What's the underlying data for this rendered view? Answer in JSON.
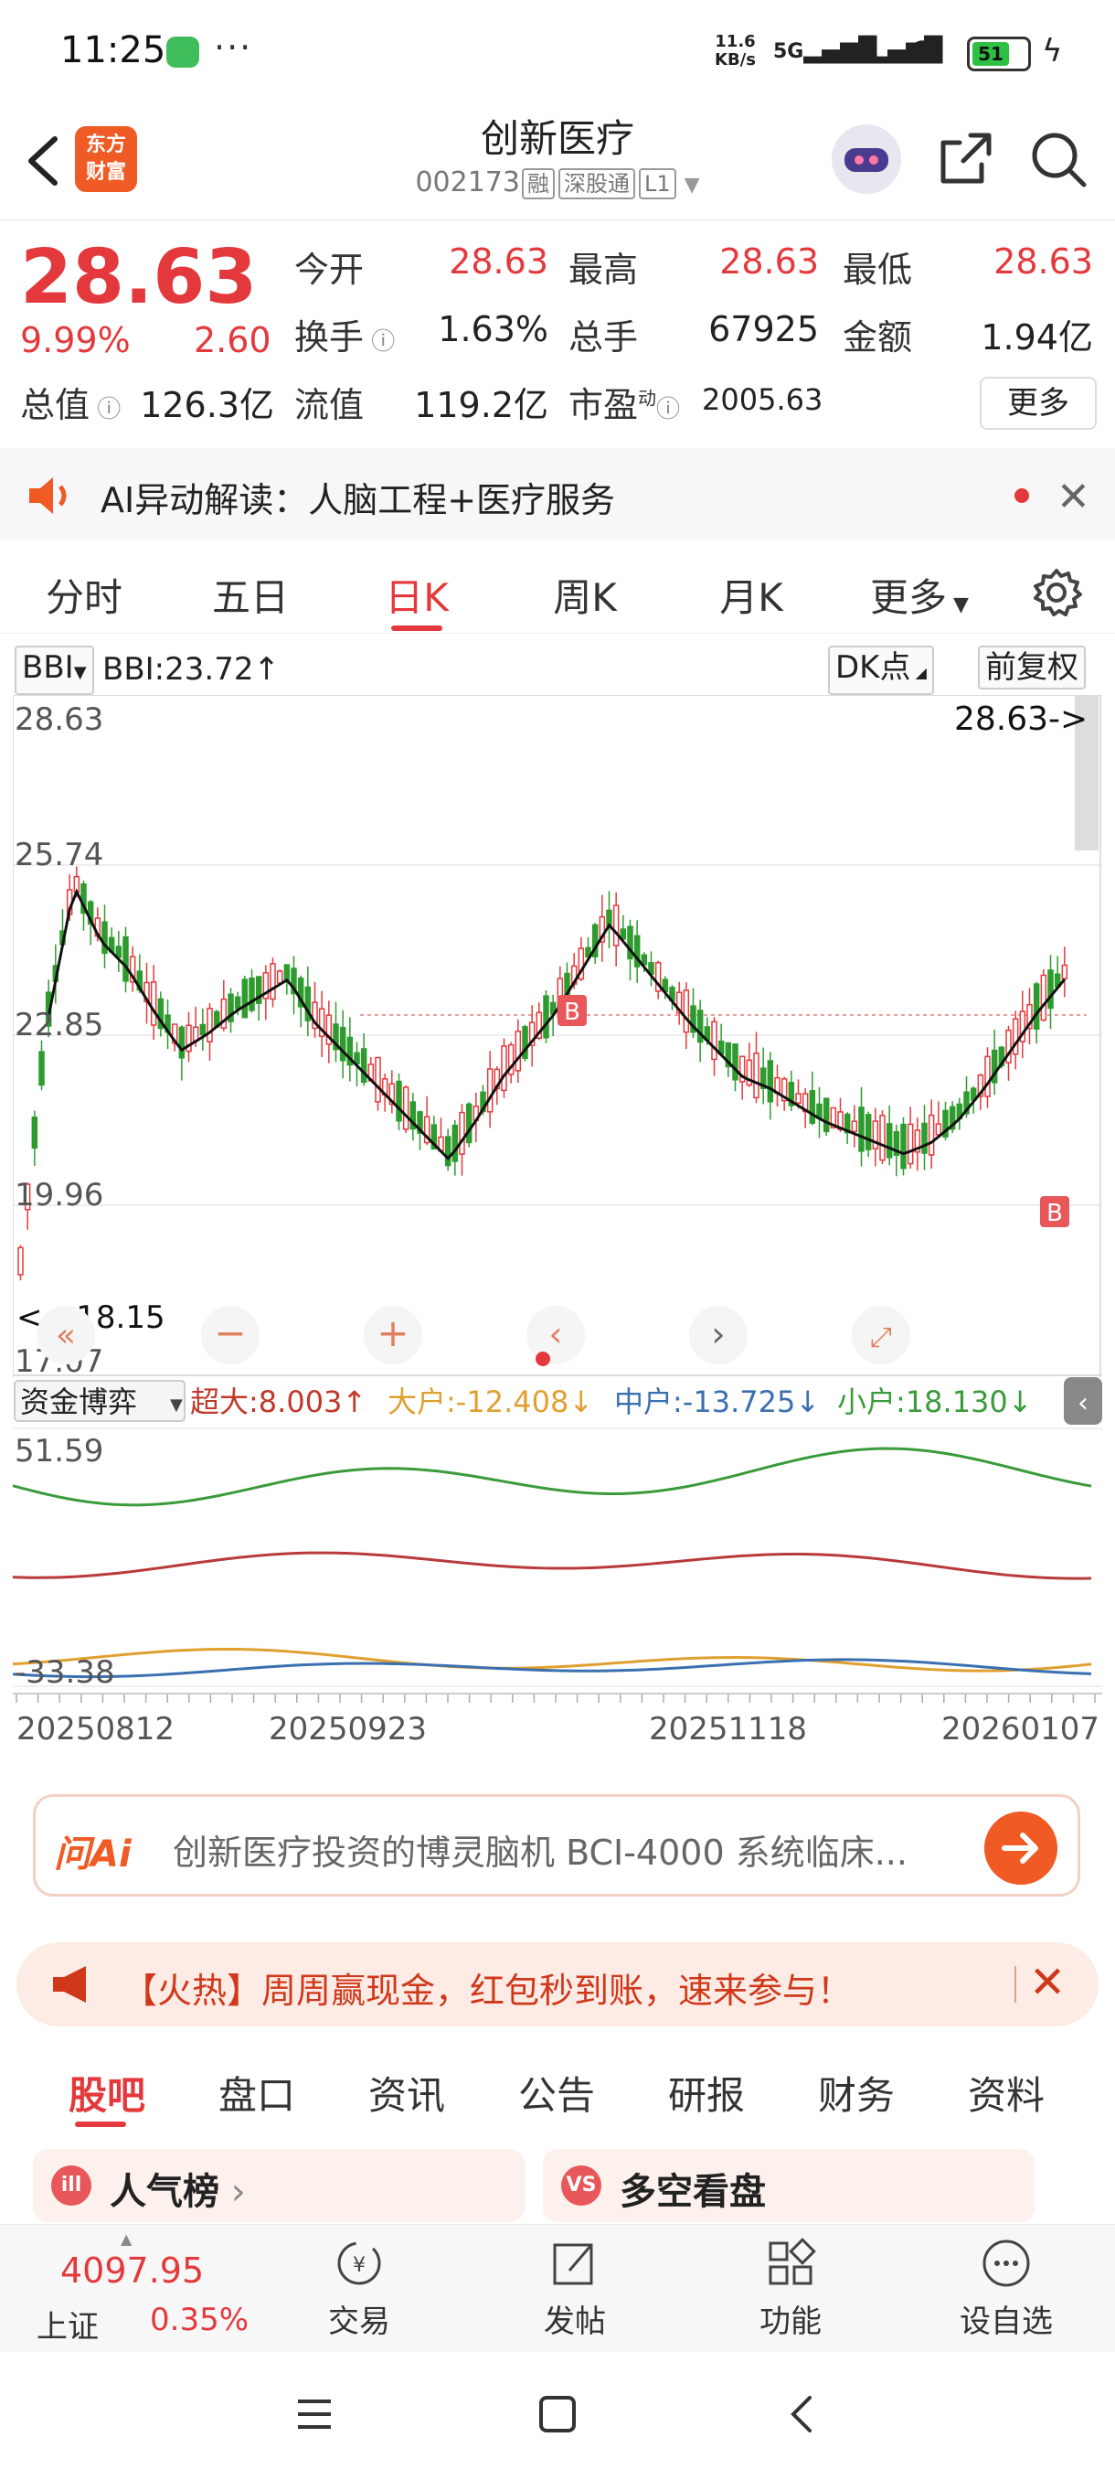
{
  "status": {
    "time": "11:25",
    "speed_top": "11.6",
    "speed_bot": "KB/s",
    "net1": "5G",
    "net2": "5G",
    "battery": "51"
  },
  "header": {
    "title": "创新医疗",
    "code": "002173",
    "tags": [
      "融",
      "深股通",
      "L1"
    ],
    "logo_line1": "东方",
    "logo_line2": "财富"
  },
  "quote": {
    "price": "28.63",
    "change_pct": "9.99%",
    "change": "2.60",
    "fields": [
      {
        "label": "今开",
        "value": "28.63",
        "color": "red"
      },
      {
        "label": "最高",
        "value": "28.63",
        "color": "red"
      },
      {
        "label": "最低",
        "value": "28.63",
        "color": "red"
      },
      {
        "label": "换手",
        "value": "1.63%",
        "color": "dark"
      },
      {
        "label": "总手",
        "value": "67925",
        "color": "dark"
      },
      {
        "label": "金额",
        "value": "1.94亿",
        "color": "dark"
      },
      {
        "label": "总值",
        "value": "126.3亿",
        "color": "dark"
      },
      {
        "label": "流值",
        "value": "119.2亿",
        "color": "dark"
      },
      {
        "label": "市盈",
        "value": "2005.63",
        "color": "dark"
      }
    ],
    "pe_sup": "动",
    "more": "更多"
  },
  "ai_banner": {
    "text": "AI异动解读：人脑工程+医疗服务"
  },
  "period_tabs": [
    "分时",
    "五日",
    "日K",
    "周K",
    "月K",
    "更多"
  ],
  "chart_header": {
    "indicator": "BBI",
    "bbi_value": "BBI:23.72",
    "dk": "DK点",
    "adjust": "前复权"
  },
  "chart_data": {
    "type": "candlestick",
    "y_ticks": [
      "28.63",
      "25.74",
      "22.85",
      "19.96",
      "17.07"
    ],
    "ylim": [
      17.07,
      28.63
    ],
    "price_tag": "28.63->",
    "low_tag": "<---18.15",
    "marker": "B",
    "x_ticks": [
      "20250812",
      "20250923",
      "20251118",
      "20260107"
    ],
    "indicator": {
      "name": "资金博弈",
      "series": [
        {
          "name": "超大",
          "value": "8.003",
          "color": "#c0392b"
        },
        {
          "name": "大户",
          "value": "-12.408",
          "color": "#e0a030"
        },
        {
          "name": "中户",
          "value": "-13.725",
          "color": "#3a6fb0"
        },
        {
          "name": "小户",
          "value": "18.130",
          "color": "#3a9b3a"
        }
      ],
      "y_ticks": [
        "51.59",
        "-33.38"
      ]
    }
  },
  "ai_input": {
    "placeholder": "创新医疗投资的博灵脑机 BCI-4000 系统临床..."
  },
  "promo": {
    "text": "【火热】周周赢现金，红包秒到账，速来参与！"
  },
  "section_tabs": [
    "股吧",
    "盘口",
    "资讯",
    "公告",
    "研报",
    "财务",
    "资料"
  ],
  "cards": [
    {
      "icon": "ill",
      "title": "人气榜"
    },
    {
      "icon": "VS",
      "title": "多空看盘"
    }
  ],
  "bottom_nav": {
    "index_value": "4097.95",
    "index_name": "上证",
    "index_pct": "0.35%",
    "items": [
      {
        "label": "交易"
      },
      {
        "label": "发帖"
      },
      {
        "label": "功能"
      },
      {
        "label": "设自选"
      }
    ]
  }
}
